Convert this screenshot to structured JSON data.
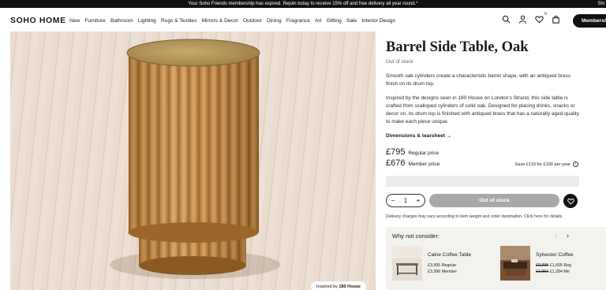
{
  "promo": {
    "message": "Your Soho Friends membership has expired. Rejoin today to receive 15% off and free delivery all year round.*",
    "right_text": "Shi"
  },
  "header": {
    "logo": "SOHO HOME",
    "menu": [
      "New",
      "Furniture",
      "Bathroom",
      "Lighting",
      "Rugs & Textiles",
      "Mirrors & Decor",
      "Outdoor",
      "Dining",
      "Fragrance",
      "Art",
      "Gifting",
      "Sale",
      "Interior Design"
    ],
    "icons": [
      "search-icon",
      "account-icon",
      "wishlist-icon",
      "bag-icon"
    ],
    "wishlist_count": "0",
    "membership_button": "Membership"
  },
  "gallery": {
    "credit_prefix": "Inspired by ",
    "credit_bold": "180 House"
  },
  "product": {
    "title": "Barrel Side Table, Oak",
    "stock": "Out of stock",
    "desc1": "Smooth oak cylinders create a characteristic barrel shape, with an antiqued brass finish on its drum top.",
    "desc2": "Inspired by the designs seen in 180 House on London's Strand, this side table is crafted from scalloped cylinders of solid oak. Designed for placing drinks, snacks or decor on, its drum top is finished with antiqued brass that has a naturally aged quality to make each piece unique.",
    "dimensions_label": "Dimensions & tearsheet",
    "regular_price": "£795",
    "regular_label": "Regular price",
    "member_price": "£676",
    "member_label": "Member price",
    "save_text": "Save £119 for £100 per year",
    "quantity": "1",
    "oos_button": "Out of stock",
    "delivery_note": "Delivery charges may vary according to item weight and order destination. Click here for details."
  },
  "consider": {
    "title": "Why not consider:",
    "items": [
      {
        "name": "Calne Coffee Table",
        "line1_price": "£3,995",
        "line1_label": "Regular",
        "line2_price": "£3,396",
        "line2_label": "Member"
      },
      {
        "name": "Sylvester Coffee",
        "line1_old": "£2,295",
        "line1_price": "£1,605",
        "line1_label": "Reg",
        "line2_old": "£1,951",
        "line2_price": "£1,284",
        "line2_label": "Me"
      }
    ]
  }
}
